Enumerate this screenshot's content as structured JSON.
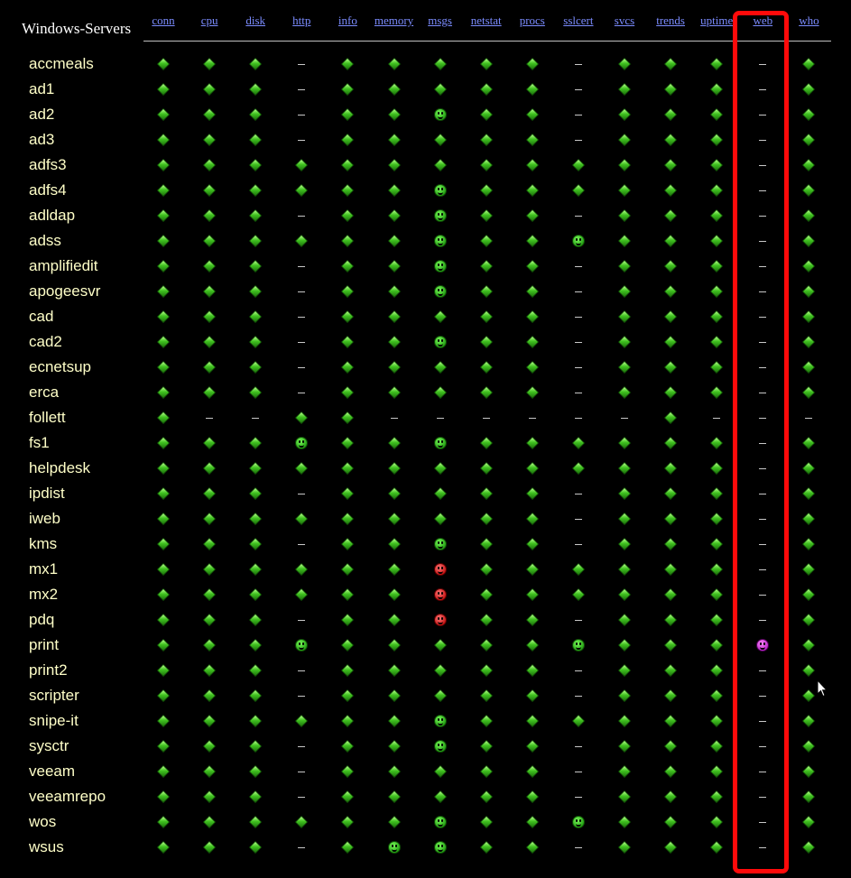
{
  "group_title": "Windows-Servers",
  "columns": [
    "conn",
    "cpu",
    "disk",
    "http",
    "info",
    "memory",
    "msgs",
    "netstat",
    "procs",
    "sslcert",
    "svcs",
    "trends",
    "uptime",
    "web",
    "who"
  ],
  "status_legend": {
    "g": "green",
    "c": "clear",
    "a": "green-acked",
    "r": "red",
    "p": "purple"
  },
  "status_colors": {
    "green": "#3fc21f",
    "red": "#c41010",
    "purple": "#b81fc8",
    "link": "#7b8cff",
    "host": "#ffffc8",
    "highlight": "#ff0a0a"
  },
  "hosts": [
    {
      "name": "accmeals",
      "status": [
        "g",
        "g",
        "g",
        "c",
        "g",
        "g",
        "g",
        "g",
        "g",
        "c",
        "g",
        "g",
        "g",
        "c",
        "g"
      ]
    },
    {
      "name": "ad1",
      "status": [
        "g",
        "g",
        "g",
        "c",
        "g",
        "g",
        "g",
        "g",
        "g",
        "c",
        "g",
        "g",
        "g",
        "c",
        "g"
      ]
    },
    {
      "name": "ad2",
      "status": [
        "g",
        "g",
        "g",
        "c",
        "g",
        "g",
        "a",
        "g",
        "g",
        "c",
        "g",
        "g",
        "g",
        "c",
        "g"
      ]
    },
    {
      "name": "ad3",
      "status": [
        "g",
        "g",
        "g",
        "c",
        "g",
        "g",
        "g",
        "g",
        "g",
        "c",
        "g",
        "g",
        "g",
        "c",
        "g"
      ]
    },
    {
      "name": "adfs3",
      "status": [
        "g",
        "g",
        "g",
        "g",
        "g",
        "g",
        "g",
        "g",
        "g",
        "g",
        "g",
        "g",
        "g",
        "c",
        "g"
      ]
    },
    {
      "name": "adfs4",
      "status": [
        "g",
        "g",
        "g",
        "g",
        "g",
        "g",
        "a",
        "g",
        "g",
        "g",
        "g",
        "g",
        "g",
        "c",
        "g"
      ]
    },
    {
      "name": "adldap",
      "status": [
        "g",
        "g",
        "g",
        "c",
        "g",
        "g",
        "a",
        "g",
        "g",
        "c",
        "g",
        "g",
        "g",
        "c",
        "g"
      ]
    },
    {
      "name": "adss",
      "status": [
        "g",
        "g",
        "g",
        "g",
        "g",
        "g",
        "a",
        "g",
        "g",
        "a",
        "g",
        "g",
        "g",
        "c",
        "g"
      ]
    },
    {
      "name": "amplifiedit",
      "status": [
        "g",
        "g",
        "g",
        "c",
        "g",
        "g",
        "a",
        "g",
        "g",
        "c",
        "g",
        "g",
        "g",
        "c",
        "g"
      ]
    },
    {
      "name": "apogeesvr",
      "status": [
        "g",
        "g",
        "g",
        "c",
        "g",
        "g",
        "a",
        "g",
        "g",
        "c",
        "g",
        "g",
        "g",
        "c",
        "g"
      ]
    },
    {
      "name": "cad",
      "status": [
        "g",
        "g",
        "g",
        "c",
        "g",
        "g",
        "g",
        "g",
        "g",
        "c",
        "g",
        "g",
        "g",
        "c",
        "g"
      ]
    },
    {
      "name": "cad2",
      "status": [
        "g",
        "g",
        "g",
        "c",
        "g",
        "g",
        "a",
        "g",
        "g",
        "c",
        "g",
        "g",
        "g",
        "c",
        "g"
      ]
    },
    {
      "name": "ecnetsup",
      "status": [
        "g",
        "g",
        "g",
        "c",
        "g",
        "g",
        "g",
        "g",
        "g",
        "c",
        "g",
        "g",
        "g",
        "c",
        "g"
      ]
    },
    {
      "name": "erca",
      "status": [
        "g",
        "g",
        "g",
        "c",
        "g",
        "g",
        "g",
        "g",
        "g",
        "c",
        "g",
        "g",
        "g",
        "c",
        "g"
      ]
    },
    {
      "name": "follett",
      "status": [
        "g",
        "c",
        "c",
        "g",
        "g",
        "c",
        "c",
        "c",
        "c",
        "c",
        "c",
        "g",
        "c",
        "c",
        "c"
      ]
    },
    {
      "name": "fs1",
      "status": [
        "g",
        "g",
        "g",
        "a",
        "g",
        "g",
        "a",
        "g",
        "g",
        "g",
        "g",
        "g",
        "g",
        "c",
        "g"
      ]
    },
    {
      "name": "helpdesk",
      "status": [
        "g",
        "g",
        "g",
        "g",
        "g",
        "g",
        "g",
        "g",
        "g",
        "g",
        "g",
        "g",
        "g",
        "c",
        "g"
      ]
    },
    {
      "name": "ipdist",
      "status": [
        "g",
        "g",
        "g",
        "c",
        "g",
        "g",
        "g",
        "g",
        "g",
        "c",
        "g",
        "g",
        "g",
        "c",
        "g"
      ]
    },
    {
      "name": "iweb",
      "status": [
        "g",
        "g",
        "g",
        "g",
        "g",
        "g",
        "g",
        "g",
        "g",
        "c",
        "g",
        "g",
        "g",
        "c",
        "g"
      ]
    },
    {
      "name": "kms",
      "status": [
        "g",
        "g",
        "g",
        "c",
        "g",
        "g",
        "a",
        "g",
        "g",
        "c",
        "g",
        "g",
        "g",
        "c",
        "g"
      ]
    },
    {
      "name": "mx1",
      "status": [
        "g",
        "g",
        "g",
        "g",
        "g",
        "g",
        "r",
        "g",
        "g",
        "g",
        "g",
        "g",
        "g",
        "c",
        "g"
      ]
    },
    {
      "name": "mx2",
      "status": [
        "g",
        "g",
        "g",
        "g",
        "g",
        "g",
        "r",
        "g",
        "g",
        "g",
        "g",
        "g",
        "g",
        "c",
        "g"
      ]
    },
    {
      "name": "pdq",
      "status": [
        "g",
        "g",
        "g",
        "c",
        "g",
        "g",
        "r",
        "g",
        "g",
        "c",
        "g",
        "g",
        "g",
        "c",
        "g"
      ]
    },
    {
      "name": "print",
      "status": [
        "g",
        "g",
        "g",
        "a",
        "g",
        "g",
        "g",
        "g",
        "g",
        "a",
        "g",
        "g",
        "g",
        "p",
        "g"
      ]
    },
    {
      "name": "print2",
      "status": [
        "g",
        "g",
        "g",
        "c",
        "g",
        "g",
        "g",
        "g",
        "g",
        "c",
        "g",
        "g",
        "g",
        "c",
        "g"
      ]
    },
    {
      "name": "scripter",
      "status": [
        "g",
        "g",
        "g",
        "c",
        "g",
        "g",
        "g",
        "g",
        "g",
        "c",
        "g",
        "g",
        "g",
        "c",
        "g"
      ]
    },
    {
      "name": "snipe-it",
      "status": [
        "g",
        "g",
        "g",
        "g",
        "g",
        "g",
        "a",
        "g",
        "g",
        "g",
        "g",
        "g",
        "g",
        "c",
        "g"
      ]
    },
    {
      "name": "sysctr",
      "status": [
        "g",
        "g",
        "g",
        "c",
        "g",
        "g",
        "a",
        "g",
        "g",
        "c",
        "g",
        "g",
        "g",
        "c",
        "g"
      ]
    },
    {
      "name": "veeam",
      "status": [
        "g",
        "g",
        "g",
        "c",
        "g",
        "g",
        "g",
        "g",
        "g",
        "c",
        "g",
        "g",
        "g",
        "c",
        "g"
      ]
    },
    {
      "name": "veeamrepo",
      "status": [
        "g",
        "g",
        "g",
        "c",
        "g",
        "g",
        "g",
        "g",
        "g",
        "c",
        "g",
        "g",
        "g",
        "c",
        "g"
      ]
    },
    {
      "name": "wos",
      "status": [
        "g",
        "g",
        "g",
        "g",
        "g",
        "g",
        "a",
        "g",
        "g",
        "a",
        "g",
        "g",
        "g",
        "c",
        "g"
      ]
    },
    {
      "name": "wsus",
      "status": [
        "g",
        "g",
        "g",
        "c",
        "g",
        "a",
        "a",
        "g",
        "g",
        "c",
        "g",
        "g",
        "g",
        "c",
        "g"
      ]
    }
  ]
}
